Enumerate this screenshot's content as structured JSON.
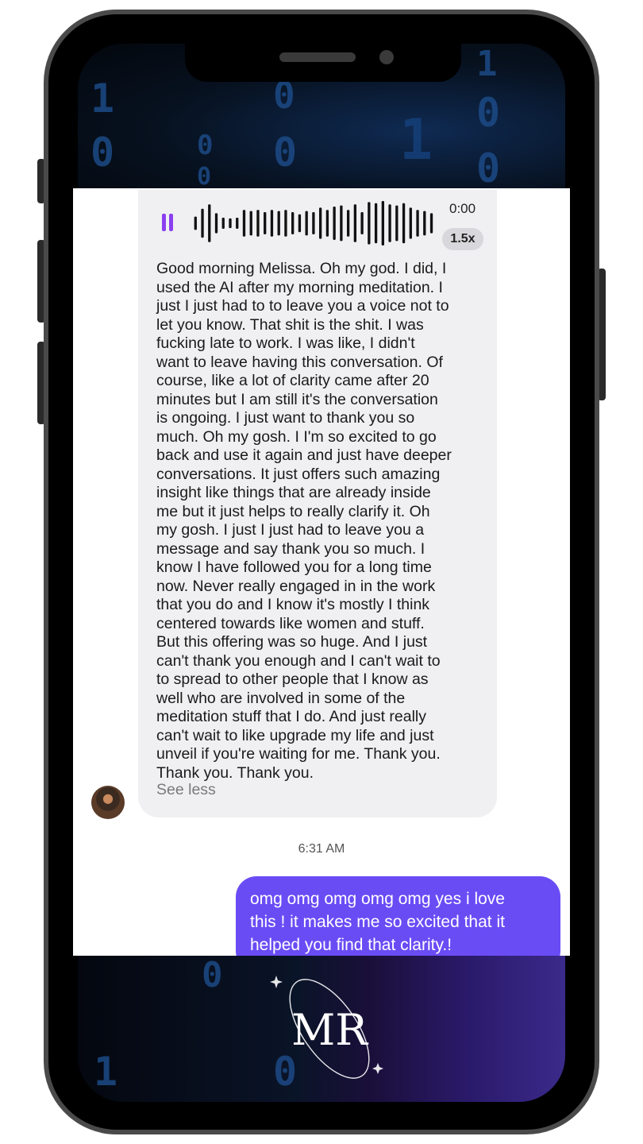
{
  "voice_message": {
    "state_icon": "pause-icon",
    "time": "0:00",
    "speed": "1.5x",
    "waveform_levels": [
      0.3,
      0.65,
      0.85,
      0.45,
      0.25,
      0.22,
      0.25,
      0.6,
      0.55,
      0.6,
      0.5,
      0.6,
      0.55,
      0.6,
      0.5,
      0.4,
      0.55,
      0.5,
      0.7,
      0.6,
      0.75,
      0.8,
      0.6,
      0.85,
      0.5,
      0.95,
      0.9,
      1.0,
      0.85,
      0.8,
      0.9,
      0.7,
      0.6,
      0.55,
      0.45
    ],
    "transcript": "Good morning Melissa. Oh my god. I did, I\nused the AI after my morning meditation. I\njust I just had to to leave you a voice not to\nlet you know. That shit is the shit. I was\nfucking late to work. I was like, I didn't\nwant to leave having this conversation. Of\ncourse, like a lot of clarity came after 20\nminutes but I am still it's the conversation\nis ongoing. I just want to thank you so\nmuch. Oh my gosh. I I'm so excited to go\nback and use it again and just have deeper\nconversations. It just offers such amazing\ninsight like things that are already inside\nme but it just helps to really clarify it. Oh\nmy gosh. I just I just had to leave you a\nmessage and say thank you so much. I\nknow I have followed you for a long time\nnow. Never really engaged in in the work\nthat you do and I know it's mostly I think\ncentered towards like women and stuff.\nBut this offering was so huge. And I just\ncan't thank you enough and I can't wait to\nto spread to other people that I know as\nwell who are involved in some of the\nmeditation stuff that I do. And just really\ncan't wait to like upgrade my life and just\nunveil if you're waiting for me. Thank you.\nThank you. Thank you.",
    "see_less": "See less"
  },
  "timestamp": "6:31 AM",
  "outgoing_message": "omg omg omg omg omg  yes i love\nthis ! it makes me so excited that it\nhelped you find that clarity.!",
  "logo_text": "MR",
  "colors": {
    "accent_purple": "#8b3ff0",
    "outgoing_bubble": "#6a4cf5",
    "incoming_bubble": "#f0f0f2"
  }
}
